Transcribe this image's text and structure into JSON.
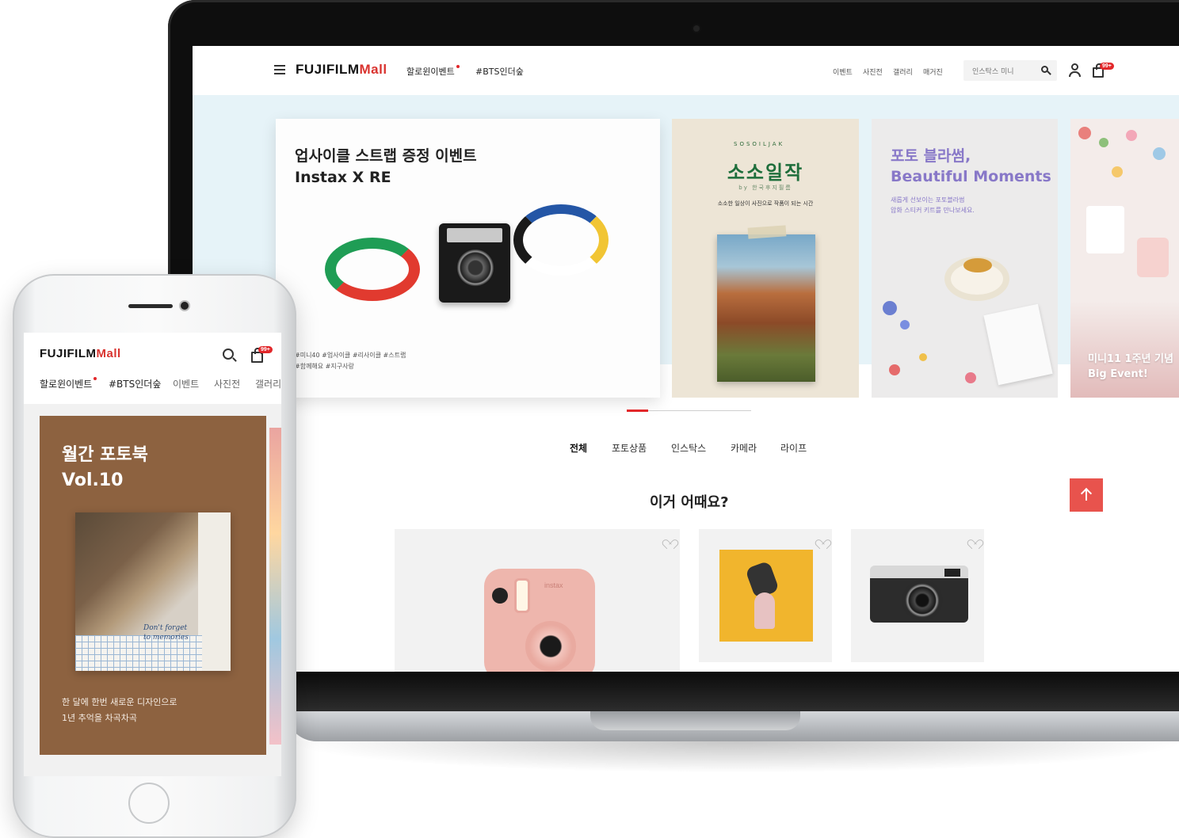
{
  "laptop": {
    "logo": {
      "text": "FUJIFILM",
      "mall": "Mall"
    },
    "nav": {
      "halloween": "할로윈이벤트",
      "bts": "#BTS인더숲"
    },
    "right_nav": [
      "이벤트",
      "사진전",
      "갤러리",
      "매거진"
    ],
    "search": {
      "placeholder": "인스탁스 미니"
    },
    "cart_badge": "99+",
    "hero": {
      "main_title_line1": "업사이클 스트랩 증정 이벤트",
      "main_title_line2": "Instax X RE",
      "main_tags_line1": "#미니40 #업사이클 #리사이클 #스트랩",
      "main_tags_line2": "#함께해요 #지구사랑",
      "soso_arc": "SOSOILJAK",
      "soso_title": "소소일작",
      "soso_by": "by 한국후지필름",
      "soso_sub": "소소한 일상이 사진으로 작품이 되는 시간",
      "photo_title_line1": "포토 블라썸,",
      "photo_title_line2": "Beautiful Moments",
      "photo_sub_line1": "새롭게 선보이는 포토블라썸",
      "photo_sub_line2": "압화 스티커 키트를 만나보세요.",
      "sticker_line1": "미니11 1주년 기념",
      "sticker_line2": "Big Event!"
    },
    "categories": [
      "전체",
      "포토상품",
      "인스탁스",
      "카메라",
      "라이프"
    ],
    "section_title": "이거 어때요?",
    "products": [
      {
        "name": "instax pink camera",
        "label": "instax"
      },
      {
        "name": "ice cream art"
      },
      {
        "name": "X100 camera"
      }
    ]
  },
  "phone": {
    "logo": {
      "text": "FUJIFILM",
      "mall": "Mall"
    },
    "cart_badge": "99+",
    "tabs": [
      "할로윈이벤트",
      "#BTS인더숲",
      "이벤트",
      "사진전",
      "갤러리"
    ],
    "book": {
      "title_line1": "월간 포토북",
      "title_line2": "Vol.10",
      "note_line1": "Don't forget",
      "note_line2": "to memories",
      "sub_line1": "한 달에 한번 새로운 디자인으로",
      "sub_line2": "1년 추억을 차곡차곡"
    }
  },
  "colors": {
    "brand_red": "#e2272a",
    "accent_button": "#e8534d",
    "book_brown": "#8d6240",
    "hero_bg": "#e6f3f8",
    "soso_green": "#1e6e3b",
    "blossom_purple": "#8878c8"
  }
}
